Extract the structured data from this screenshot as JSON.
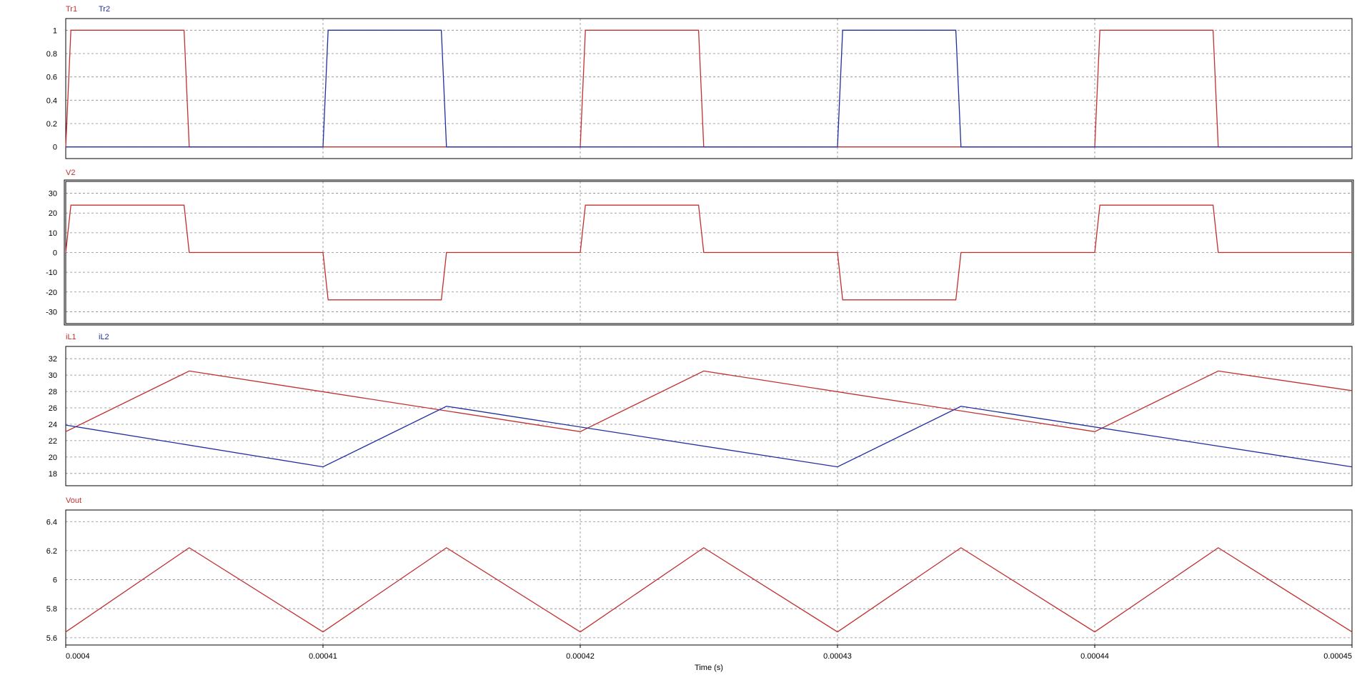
{
  "chart_data": [
    {
      "type": "line",
      "xlim": [
        0.0004,
        0.00045
      ],
      "ylim": [
        -0.1,
        1.1
      ],
      "yticks": [
        0,
        0.2,
        0.4,
        0.6,
        0.8,
        1
      ],
      "ytick_labels": [
        "0",
        "0.2",
        "0.4",
        "0.6",
        "0.8",
        "1"
      ],
      "grid": true,
      "legend_position": "top-left",
      "series": [
        {
          "name": "Tr1",
          "color": "#c0302f",
          "x": [
            0.0004,
            0.0004002,
            0.0004046,
            0.0004048,
            0.0004098,
            0.00041,
            0.0004102,
            0.0004146,
            0.0004148,
            0.0004198,
            0.00042,
            0.0004202,
            0.0004246,
            0.0004248,
            0.0004298,
            0.00043,
            0.0004302,
            0.0004346,
            0.0004348,
            0.0004398,
            0.00044,
            0.0004402,
            0.0004446,
            0.0004448,
            0.00045
          ],
          "y": [
            0,
            1,
            1,
            0,
            0,
            0,
            0,
            0,
            0,
            0,
            0,
            1,
            1,
            0,
            0,
            0,
            0,
            0,
            0,
            0,
            0,
            1,
            1,
            0,
            0
          ]
        },
        {
          "name": "Tr2",
          "color": "#1f2f9f",
          "x": [
            0.0004,
            0.0004098,
            0.00041,
            0.0004102,
            0.0004146,
            0.0004148,
            0.0004198,
            0.00042,
            0.0004298,
            0.00043,
            0.0004302,
            0.0004346,
            0.0004348,
            0.0004398,
            0.00045
          ],
          "y": [
            0,
            0,
            0,
            1,
            1,
            0,
            0,
            0,
            0,
            0,
            1,
            1,
            0,
            0,
            0
          ]
        }
      ]
    },
    {
      "type": "line",
      "xlim": [
        0.0004,
        0.00045
      ],
      "ylim": [
        -36,
        36
      ],
      "yticks": [
        -30,
        -20,
        -10,
        0,
        10,
        20,
        30
      ],
      "ytick_labels": [
        "-30",
        "-20",
        "-10",
        "0",
        "10",
        "20",
        "30"
      ],
      "grid": true,
      "legend_position": "top-left",
      "series": [
        {
          "name": "V2",
          "color": "#c0302f",
          "x": [
            0.0004,
            0.0004002,
            0.0004046,
            0.0004048,
            0.0004098,
            0.00041,
            0.0004102,
            0.0004146,
            0.0004148,
            0.0004198,
            0.00042,
            0.0004202,
            0.0004246,
            0.0004248,
            0.0004298,
            0.00043,
            0.0004302,
            0.0004346,
            0.0004348,
            0.0004398,
            0.00044,
            0.0004402,
            0.0004446,
            0.0004448,
            0.00045
          ],
          "y": [
            0,
            24,
            24,
            0,
            0,
            0,
            -24,
            -24,
            0,
            0,
            0,
            24,
            24,
            0,
            0,
            0,
            -24,
            -24,
            0,
            0,
            0,
            24,
            24,
            0,
            0
          ]
        }
      ]
    },
    {
      "type": "line",
      "xlim": [
        0.0004,
        0.00045
      ],
      "ylim": [
        16.5,
        33.5
      ],
      "yticks": [
        18,
        20,
        22,
        24,
        26,
        28,
        30,
        32
      ],
      "ytick_labels": [
        "18",
        "20",
        "22",
        "24",
        "26",
        "28",
        "30",
        "32"
      ],
      "grid": true,
      "legend_position": "top-left",
      "series": [
        {
          "name": "iL1",
          "color": "#c0302f",
          "x": [
            0.0004,
            0.0004048,
            0.00042,
            0.0004248,
            0.00044,
            0.0004448,
            0.00045
          ],
          "y": [
            23.1,
            30.5,
            23.1,
            30.5,
            23.1,
            30.5,
            28.1
          ]
        },
        {
          "name": "iL2",
          "color": "#1f2f9f",
          "x": [
            0.0004,
            0.00041,
            0.0004148,
            0.00043,
            0.0004348,
            0.00045
          ],
          "y": [
            23.9,
            18.8,
            26.2,
            18.8,
            26.2,
            18.8
          ]
        }
      ]
    },
    {
      "type": "line",
      "xlim": [
        0.0004,
        0.00045
      ],
      "ylim": [
        5.55,
        6.48
      ],
      "yticks": [
        5.6,
        5.8,
        6,
        6.2,
        6.4
      ],
      "ytick_labels": [
        "5.6",
        "5.8",
        "6",
        "6.2",
        "6.4"
      ],
      "grid": true,
      "legend_position": "top-left",
      "xticks": [
        0.0004,
        0.00041,
        0.00042,
        0.00043,
        0.00044,
        0.00045
      ],
      "xtick_labels": [
        "0.0004",
        "0.00041",
        "0.00042",
        "0.00043",
        "0.00044",
        "0.00045"
      ],
      "xlabel": "Time (s)",
      "series": [
        {
          "name": "Vout",
          "color": "#c0302f",
          "x": [
            0.0004,
            0.0004048,
            0.00041,
            0.0004148,
            0.00042,
            0.0004248,
            0.00043,
            0.0004348,
            0.00044,
            0.0004448,
            0.00045
          ],
          "y": [
            5.64,
            6.22,
            5.64,
            6.22,
            5.64,
            6.22,
            5.64,
            6.22,
            5.64,
            6.22,
            5.64
          ]
        }
      ]
    }
  ]
}
